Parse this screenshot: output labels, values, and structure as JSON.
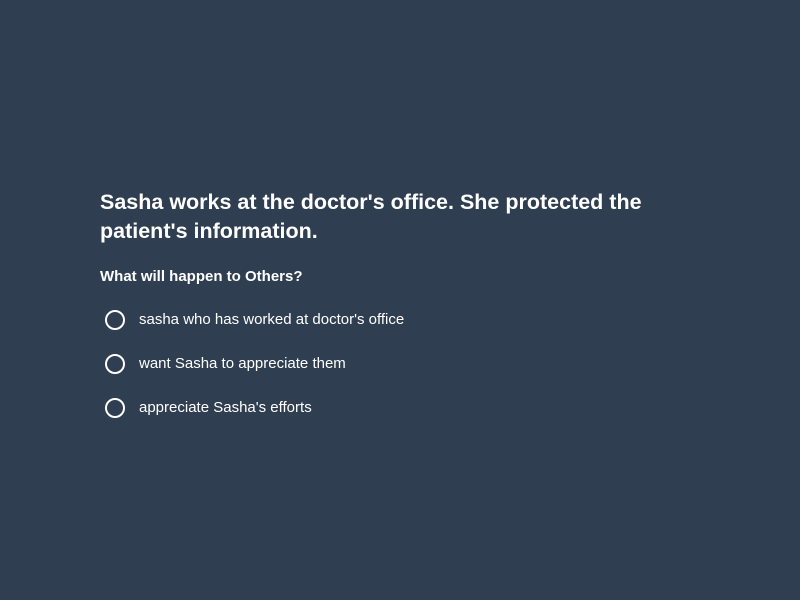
{
  "prompt": "Sasha works at the doctor's office. She protected the patient's information.",
  "question": "What will happen to Others?",
  "options": [
    {
      "label": "sasha who has worked at doctor's office"
    },
    {
      "label": "want Sasha to appreciate them"
    },
    {
      "label": "appreciate Sasha's efforts"
    }
  ],
  "colors": {
    "background": "#2f3e50",
    "text": "#ffffff"
  }
}
